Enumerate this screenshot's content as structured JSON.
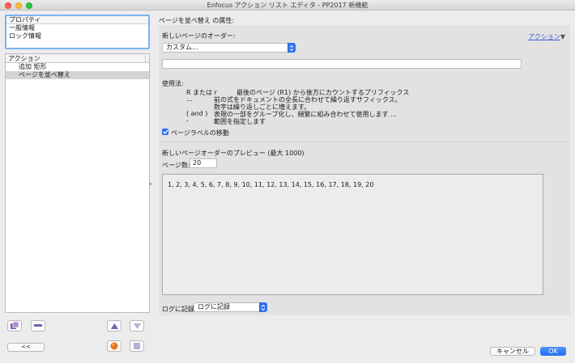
{
  "window": {
    "title": "Enfocus アクション リスト エディタ - PP2017 新機能"
  },
  "properties": {
    "header": "プロパティ",
    "items": [
      "一般情報",
      "ロック情報"
    ]
  },
  "actions": {
    "header": "アクション",
    "items": [
      {
        "label": "追加 矩形",
        "selected": false
      },
      {
        "label": "ページを並べ替え",
        "selected": true
      }
    ]
  },
  "left_buttons": {
    "back_label": "<<"
  },
  "main": {
    "attributes_title": "ページを並べ替え の属性:",
    "order_label": "新しいページのオーダー:",
    "order_value": "カスタム...",
    "action_link": "アクション",
    "custom_text": "",
    "usage_label": "使用法:",
    "usage": [
      {
        "key": "R または r",
        "desc": "最後のページ (R1) から後方にカウントするプリフィックス"
      },
      {
        "key": "...",
        "desc": "前の式をドキュメントの全長に合わせて繰り返すサフィックス。"
      },
      {
        "key": "",
        "desc": "数字は繰り返しごとに増えます。"
      },
      {
        "key": "( and )",
        "desc": "表現の一部をグループ化し、頻繁に組み合わせて使用します ..."
      },
      {
        "key": "-",
        "desc": "範囲を指定します"
      }
    ],
    "move_labels_label": "ページラベルの移動",
    "move_labels_checked": true,
    "preview_title": "新しいページオーダーのプレビュー (最大 1000)",
    "page_count_label": "ページ数:",
    "page_count_value": "20",
    "preview_text": "1, 2, 3, 4, 5, 6, 7, 8, 9, 10, 11, 12, 13, 14, 15, 16, 17, 18, 19, 20",
    "log_label": "ログに記録",
    "log_value": "ログに記録"
  },
  "footer": {
    "cancel_label": "キャンセル",
    "ok_label": "OK"
  },
  "colors": {
    "accent": "#2d6ff0",
    "link": "#3d58d6",
    "selection": "#d4d4d4"
  }
}
